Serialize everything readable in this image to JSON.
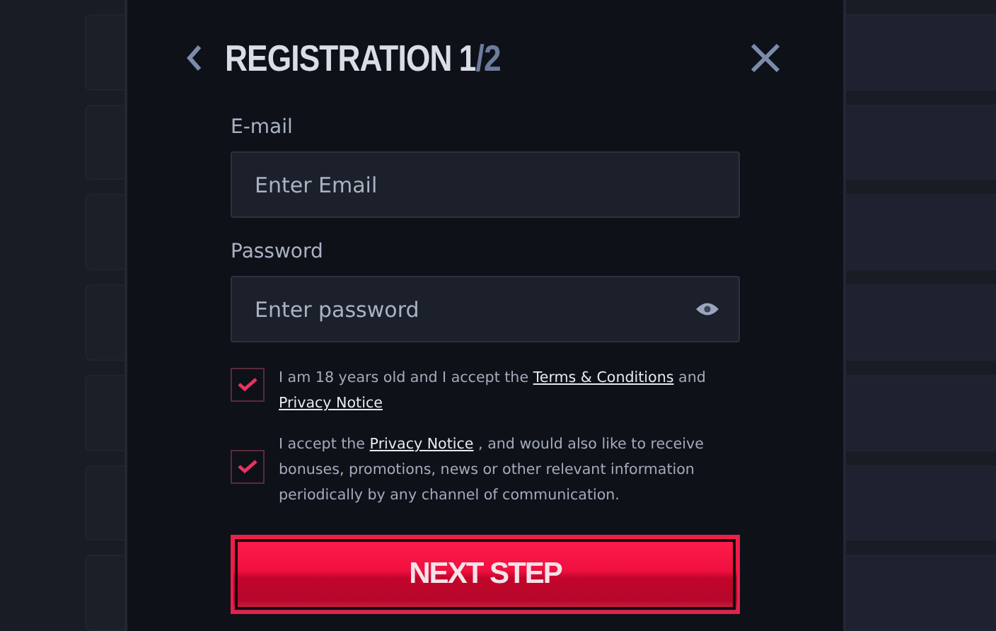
{
  "dialog": {
    "title": "REGISTRATION",
    "step_current": "1",
    "step_total": "/2"
  },
  "fields": [
    {
      "label": "E-mail",
      "placeholder": "Enter Email",
      "kind": "email"
    },
    {
      "label": "Password",
      "placeholder": "Enter password",
      "kind": "password"
    }
  ],
  "consents": [
    {
      "checked": true,
      "segments": [
        {
          "kind": "text",
          "text": "I am 18 years old and I accept the "
        },
        {
          "kind": "link",
          "text": "Terms & Conditions"
        },
        {
          "kind": "text",
          "text": " and "
        },
        {
          "kind": "link",
          "text": "Privacy Notice"
        }
      ]
    },
    {
      "checked": true,
      "segments": [
        {
          "kind": "text",
          "text": "I accept the "
        },
        {
          "kind": "link",
          "text": "Privacy Notice"
        },
        {
          "kind": "text",
          "text": " , and would also like to receive bonuses, promotions, news or other relevant information periodically by any channel of communication."
        }
      ]
    }
  ],
  "submit": {
    "label": "NEXT STEP"
  }
}
